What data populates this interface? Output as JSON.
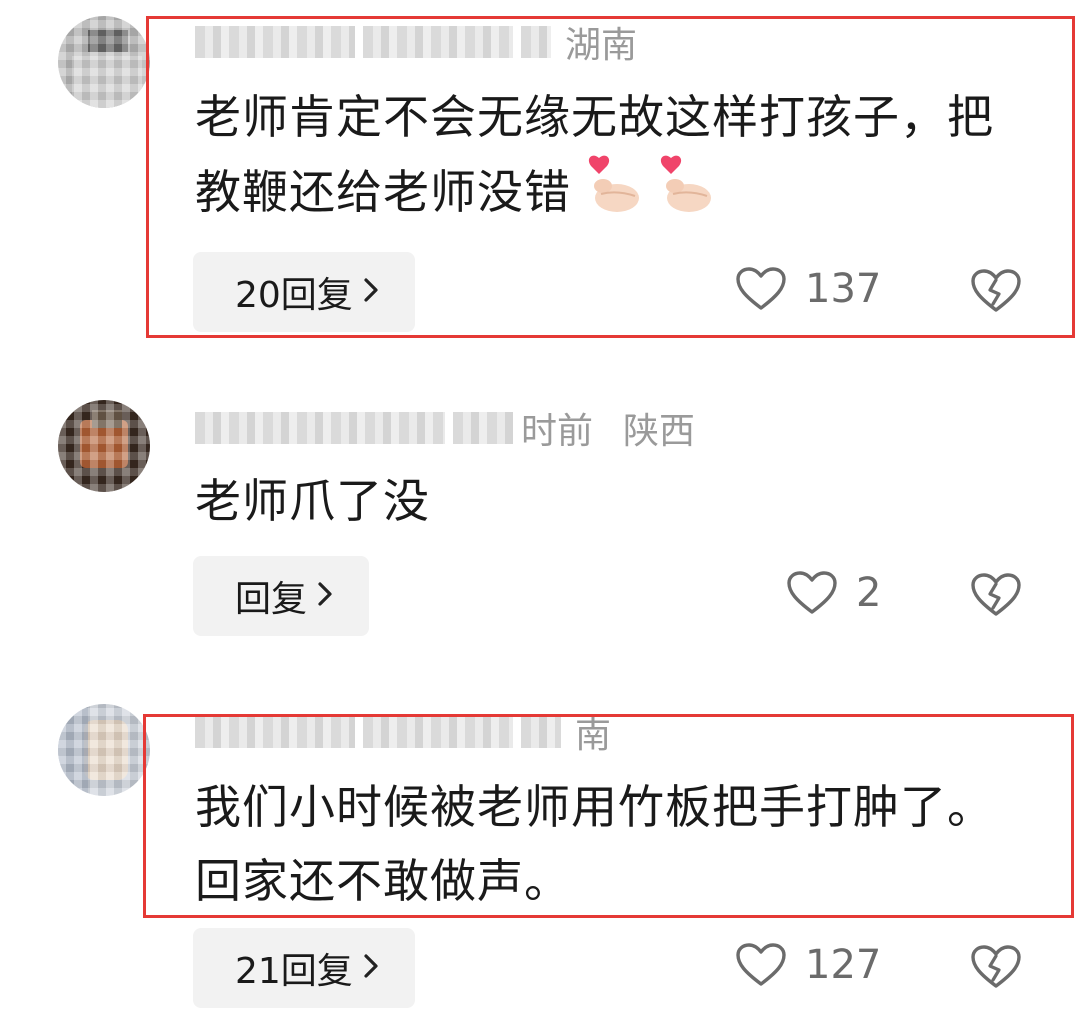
{
  "comments": [
    {
      "meta_location": "湖南",
      "text": "老师肯定不会无缘无故这样打孩子，把教鞭还给老师没错",
      "reply_label": "20回复",
      "likes": "137"
    },
    {
      "meta_time": "时前",
      "meta_location": "陕西",
      "text": "老师爪了没",
      "reply_label": "回复",
      "likes": "2"
    },
    {
      "meta_location": "南",
      "text": "我们小时候被老师用竹板把手打肿了。回家还不敢做声。",
      "reply_label": "21回复",
      "likes": "127"
    }
  ],
  "icons": {
    "like": "heart-outline-icon",
    "dislike": "broken-heart-icon",
    "chevron": "chevron-right-icon",
    "emoji": "finger-heart-emoji"
  },
  "colors": {
    "highlight": "#e53935",
    "reply_bg": "#f2f2f2",
    "meta_text": "#9a9a9a",
    "body_text": "#1a1a1a",
    "icon": "#6b6b6b"
  }
}
